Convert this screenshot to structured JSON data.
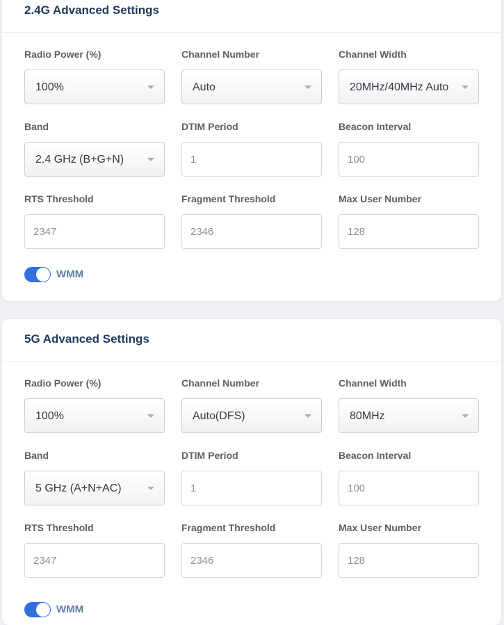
{
  "sections": [
    {
      "title": "2.4G Advanced Settings",
      "radio_power_label": "Radio Power (%)",
      "radio_power_value": "100%",
      "channel_number_label": "Channel Number",
      "channel_number_value": "Auto",
      "channel_width_label": "Channel Width",
      "channel_width_value": "20MHz/40MHz Auto",
      "band_label": "Band",
      "band_value": "2.4 GHz (B+G+N)",
      "dtim_label": "DTIM Period",
      "dtim_value": "1",
      "beacon_label": "Beacon Interval",
      "beacon_value": "100",
      "rts_label": "RTS Threshold",
      "rts_value": "2347",
      "fragment_label": "Fragment Threshold",
      "fragment_value": "2346",
      "max_user_label": "Max User Number",
      "max_user_value": "128",
      "wmm_label": "WMM",
      "wmm_enabled": true
    },
    {
      "title": "5G Advanced Settings",
      "radio_power_label": "Radio Power (%)",
      "radio_power_value": "100%",
      "channel_number_label": "Channel Number",
      "channel_number_value": "Auto(DFS)",
      "channel_width_label": "Channel Width",
      "channel_width_value": "80MHz",
      "band_label": "Band",
      "band_value": "5 GHz (A+N+AC)",
      "dtim_label": "DTIM Period",
      "dtim_value": "1",
      "beacon_label": "Beacon Interval",
      "beacon_value": "100",
      "rts_label": "RTS Threshold",
      "rts_value": "2347",
      "fragment_label": "Fragment Threshold",
      "fragment_value": "2346",
      "max_user_label": "Max User Number",
      "max_user_value": "128",
      "wmm_label": "WMM",
      "wmm_enabled": true
    }
  ],
  "colors": {
    "accent": "#3170e0",
    "title": "#1e3a5c",
    "label": "#5a5f66",
    "toggle_label": "#5f7ea3"
  },
  "icons": {
    "select_arrow": "chevron-down-icon"
  }
}
